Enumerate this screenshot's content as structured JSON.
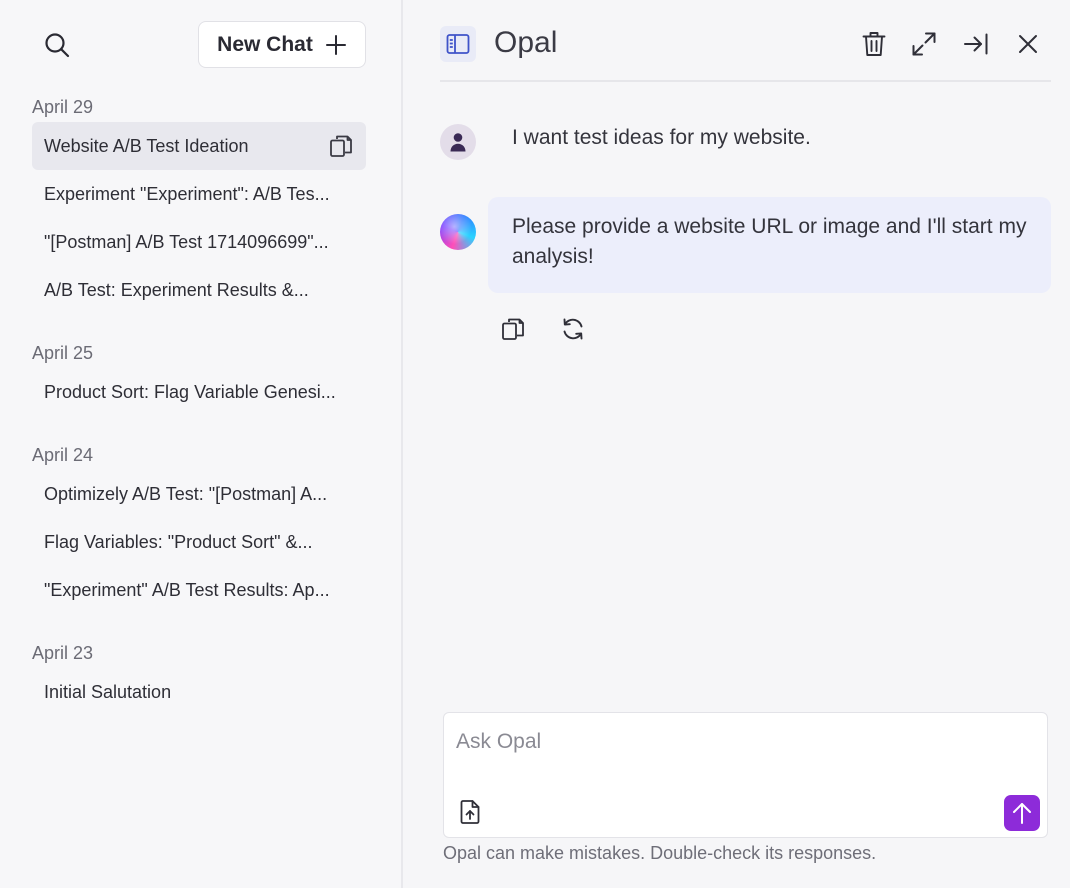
{
  "sidebar": {
    "new_chat_label": "New Chat",
    "groups": [
      {
        "label": "April 29",
        "items": [
          "Website A/B Test Ideation",
          "Experiment \"Experiment\": A/B Tes...",
          "\"[Postman] A/B Test 1714096699\"...",
          "A/B Test: Experiment Results &..."
        ]
      },
      {
        "label": "April 25",
        "items": [
          "Product Sort: Flag Variable Genesi..."
        ]
      },
      {
        "label": "April 24",
        "items": [
          "Optimizely A/B Test: \"[Postman] A...",
          "Flag Variables: \"Product Sort\" &...",
          "\"Experiment\" A/B Test Results: Ap..."
        ]
      },
      {
        "label": "April 23",
        "items": [
          "Initial Salutation"
        ]
      }
    ]
  },
  "header": {
    "title": "Opal"
  },
  "conversation": {
    "user_message": "I want test ideas for my website.",
    "assistant_message": "Please provide a website URL or image and I'll start my analysis!"
  },
  "composer": {
    "placeholder": "Ask Opal",
    "value": ""
  },
  "disclaimer": "Opal can make mistakes. Double-check its responses.",
  "colors": {
    "accent": "#8d2bd9",
    "bubble": "#eceefb",
    "active_item": "#e8e8ee"
  },
  "icons": {
    "sidebar": [
      "search-icon",
      "plus-icon",
      "copy-icon"
    ],
    "header": [
      "sidebar-panel-icon",
      "trash-icon",
      "expand-icon",
      "collapse-right-icon",
      "close-icon"
    ],
    "message_actions": [
      "copy-icon",
      "regenerate-icon"
    ],
    "composer": [
      "attach-file-icon",
      "arrow-up-icon"
    ]
  }
}
